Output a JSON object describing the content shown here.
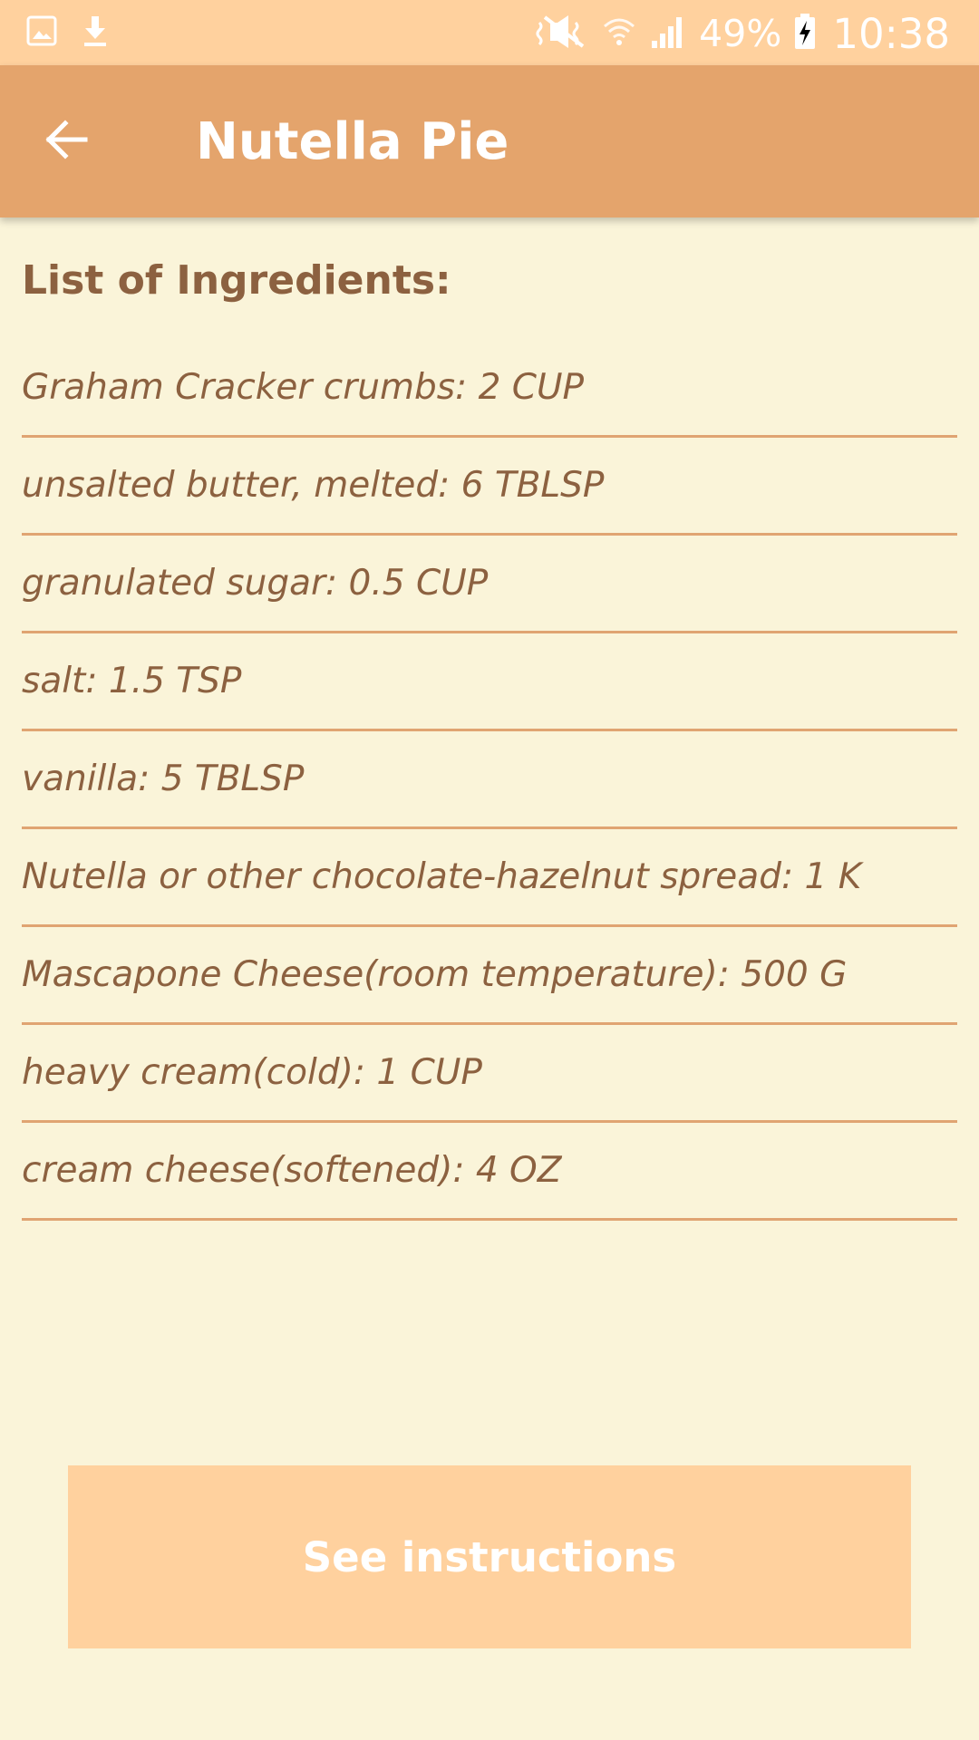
{
  "status_bar": {
    "battery_percent": "49%",
    "time": "10:38",
    "icons": [
      "gallery-icon",
      "download-icon",
      "mute-icon",
      "wifi-icon",
      "signal-icon",
      "battery-charging-icon"
    ]
  },
  "app_bar": {
    "title": "Nutella Pie",
    "back_icon": "arrow-back-icon"
  },
  "ingredients": {
    "heading": "List of Ingredients:",
    "items": [
      "Graham Cracker crumbs: 2 CUP",
      "unsalted butter, melted: 6 TBLSP",
      "granulated sugar: 0.5 CUP",
      "salt: 1.5 TSP",
      "vanilla: 5 TBLSP",
      "Nutella or other chocolate-hazelnut spread: 1 K",
      "Mascapone Cheese(room temperature): 500 G",
      "heavy cream(cold): 1 CUP",
      "cream cheese(softened): 4 OZ"
    ]
  },
  "actions": {
    "see_instructions_label": "See instructions"
  },
  "colors": {
    "status_bar": "#FFD19E",
    "app_bar": "#E4A46C",
    "background": "#FAF4D9",
    "text": "#8C6140",
    "divider": "#E0A472",
    "button": "#FFD19E"
  }
}
